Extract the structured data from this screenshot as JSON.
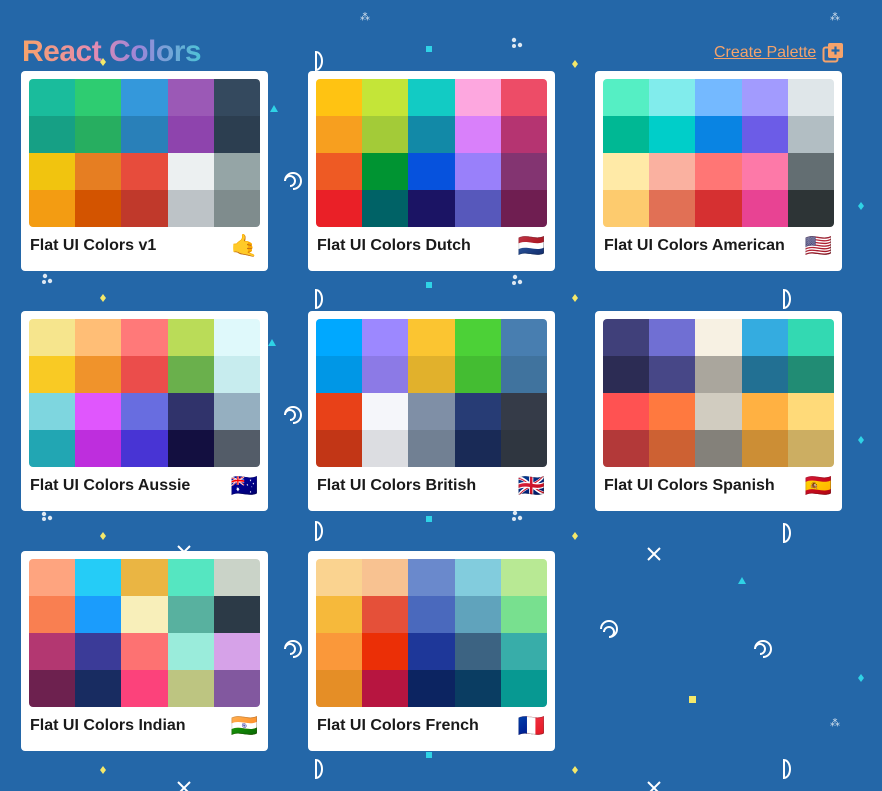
{
  "app": {
    "title": "React Colors"
  },
  "header": {
    "create_label": "Create Palette"
  },
  "colors": {
    "background": "#2467a8",
    "accent": "#f5a36b"
  },
  "palettes": [
    {
      "name": "Flat UI Colors v1",
      "emoji": "🤙",
      "swatches": [
        "#1abc9c",
        "#2ecc71",
        "#3498db",
        "#9b59b6",
        "#34495e",
        "#16a085",
        "#27ae60",
        "#2980b9",
        "#8e44ad",
        "#2c3e50",
        "#f1c40f",
        "#e67e22",
        "#e74c3c",
        "#ecf0f1",
        "#95a5a6",
        "#f39c12",
        "#d35400",
        "#c0392b",
        "#bdc3c7",
        "#7f8c8d"
      ]
    },
    {
      "name": "Flat UI Colors Dutch",
      "emoji": "🇳🇱",
      "swatches": [
        "#ffc312",
        "#c4e538",
        "#12cbc4",
        "#fda7df",
        "#ed4c67",
        "#f79f1f",
        "#a3cb38",
        "#1289a7",
        "#d980fa",
        "#b53471",
        "#ee5a24",
        "#009432",
        "#0652dd",
        "#9980fa",
        "#833471",
        "#ea2027",
        "#006266",
        "#1b1464",
        "#5758bb",
        "#6f1e51"
      ]
    },
    {
      "name": "Flat UI Colors American",
      "emoji": "🇺🇸",
      "swatches": [
        "#55efc4",
        "#81ecec",
        "#74b9ff",
        "#a29bfe",
        "#dfe6e9",
        "#00b894",
        "#00cec9",
        "#0984e3",
        "#6c5ce7",
        "#b2bec3",
        "#ffeaa7",
        "#fab1a0",
        "#ff7675",
        "#fd79a8",
        "#636e72",
        "#fdcb6e",
        "#e17055",
        "#d63031",
        "#e84393",
        "#2d3436"
      ]
    },
    {
      "name": "Flat UI Colors Aussie",
      "emoji": "🇦🇺",
      "swatches": [
        "#f6e58d",
        "#ffbe76",
        "#ff7979",
        "#badc58",
        "#dff9fb",
        "#f9ca24",
        "#f0932b",
        "#eb4d4b",
        "#6ab04c",
        "#c7ecee",
        "#7ed6df",
        "#e056fd",
        "#686de0",
        "#30336b",
        "#95afc0",
        "#22a6b3",
        "#be2edd",
        "#4834d4",
        "#130f40",
        "#535c68"
      ]
    },
    {
      "name": "Flat UI Colors British",
      "emoji": "🇬🇧",
      "swatches": [
        "#00a8ff",
        "#9c88ff",
        "#fbc531",
        "#4cd137",
        "#487eb0",
        "#0097e6",
        "#8c7ae6",
        "#e1b12c",
        "#44bd32",
        "#40739e",
        "#e84118",
        "#f5f6fa",
        "#7f8fa6",
        "#273c75",
        "#353b48",
        "#c23616",
        "#dcdde1",
        "#718093",
        "#192a56",
        "#2f3640"
      ]
    },
    {
      "name": "Flat UI Colors Spanish",
      "emoji": "🇪🇸",
      "swatches": [
        "#40407a",
        "#706fd3",
        "#f7f1e3",
        "#34ace0",
        "#33d9b2",
        "#2c2c54",
        "#474787",
        "#aaa69d",
        "#227093",
        "#218c74",
        "#ff5252",
        "#ff793f",
        "#d1ccc0",
        "#ffb142",
        "#ffda79",
        "#b33939",
        "#cd6133",
        "#84817a",
        "#cc8e35",
        "#ccae62"
      ]
    },
    {
      "name": "Flat UI Colors Indian",
      "emoji": "🇮🇳",
      "swatches": [
        "#fea47f",
        "#25ccf7",
        "#eab543",
        "#55e6c1",
        "#cad3c8",
        "#f97f51",
        "#1b9cfc",
        "#f8efba",
        "#58b19f",
        "#2c3a47",
        "#b33771",
        "#3b3b98",
        "#fd7272",
        "#9aecdb",
        "#d6a2e8",
        "#6d214f",
        "#182c61",
        "#fc427b",
        "#bdc581",
        "#82589f"
      ]
    },
    {
      "name": "Flat UI Colors French",
      "emoji": "🇫🇷",
      "swatches": [
        "#fad390",
        "#f8c291",
        "#6a89cc",
        "#82ccdd",
        "#b8e994",
        "#f6b93b",
        "#e55039",
        "#4a69bd",
        "#60a3bc",
        "#78e08f",
        "#fa983a",
        "#eb2f06",
        "#1e3799",
        "#3c6382",
        "#38ada9",
        "#e58e26",
        "#b71540",
        "#0c2461",
        "#0a3d62",
        "#079992"
      ]
    }
  ]
}
